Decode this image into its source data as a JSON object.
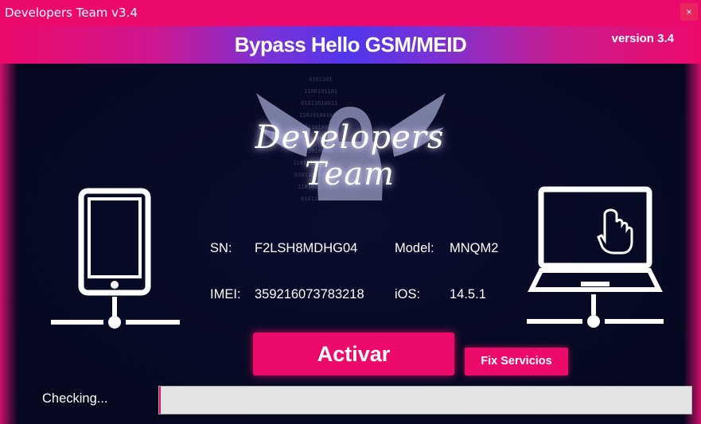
{
  "window": {
    "title": "Developers Team v3.4",
    "close_label": "×"
  },
  "banner": {
    "title": "Bypass Hello GSM/MEID",
    "version": "version 3.4"
  },
  "logo": {
    "text": "Developers Team"
  },
  "device": {
    "sn_label": "SN:",
    "sn": "F2LSH8MDHG04",
    "model_label": "Model:",
    "model": "MNQM2",
    "imei_label": "IMEI:",
    "imei": "359216073783218",
    "ios_label": "iOS:",
    "ios": "14.5.1"
  },
  "buttons": {
    "activar": "Activar",
    "fix": "Fix Servicios"
  },
  "status": {
    "text": "Checking...",
    "progress": 0.003
  },
  "colors": {
    "accent": "#eb0a6b",
    "background": "#05081e",
    "banner_mid": "#5137ec"
  }
}
